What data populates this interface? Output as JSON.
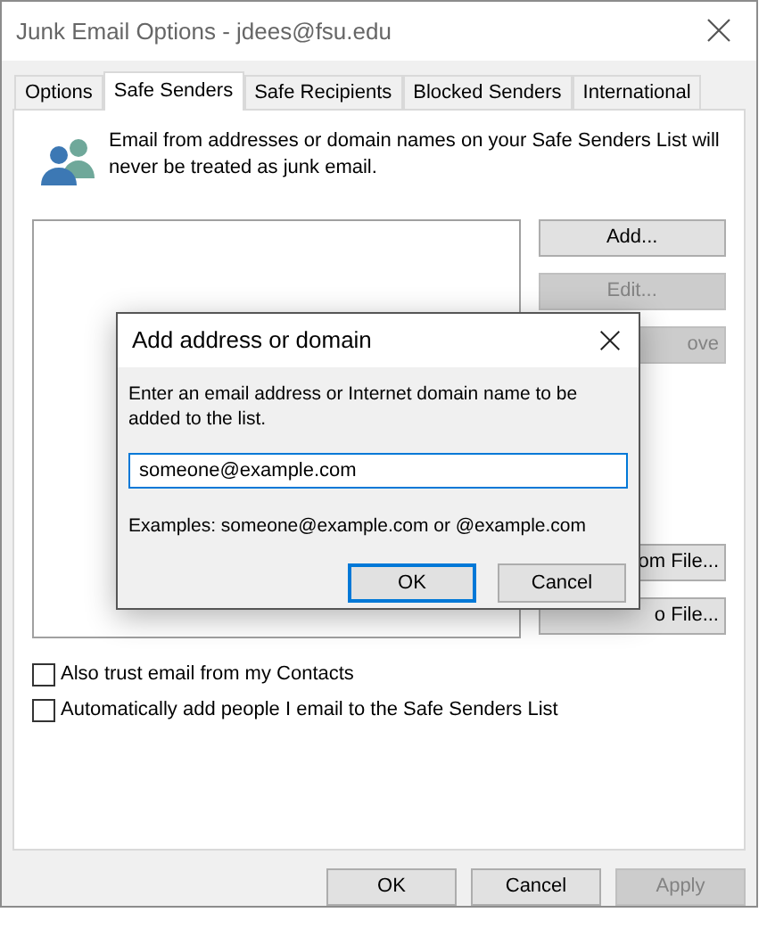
{
  "window": {
    "title": "Junk Email Options - jdees@fsu.edu"
  },
  "tabs": [
    {
      "label": "Options",
      "selected": false
    },
    {
      "label": "Safe Senders",
      "selected": true
    },
    {
      "label": "Safe Recipients",
      "selected": false
    },
    {
      "label": "Blocked Senders",
      "selected": false
    },
    {
      "label": "International",
      "selected": false
    }
  ],
  "info": "Email from addresses or domain names on your Safe Senders List will never be treated as junk email.",
  "side_buttons": [
    {
      "label": "Add...",
      "disabled": false,
      "covered": false
    },
    {
      "label": "Edit...",
      "disabled": true,
      "covered": false
    },
    {
      "label": "ove",
      "disabled": true,
      "covered": true
    },
    {
      "label": "om File...",
      "disabled": false,
      "covered": true
    },
    {
      "label": "o File...",
      "disabled": false,
      "covered": true
    }
  ],
  "checkboxes": [
    {
      "label": "Also trust email from my Contacts",
      "checked": false
    },
    {
      "label": "Automatically add people I email to the Safe Senders List",
      "checked": false
    }
  ],
  "footer_buttons": [
    {
      "label": "OK",
      "disabled": false
    },
    {
      "label": "Cancel",
      "disabled": false
    },
    {
      "label": "Apply",
      "disabled": true
    }
  ],
  "add_dialog": {
    "title": "Add address or domain",
    "prompt": "Enter an email address or Internet domain name to be added to the list.",
    "input": {
      "value": "someone@example.com"
    },
    "examples": "Examples: someone@example.com or @example.com",
    "buttons": [
      {
        "label": "OK",
        "default": true
      },
      {
        "label": "Cancel",
        "default": false
      }
    ]
  }
}
